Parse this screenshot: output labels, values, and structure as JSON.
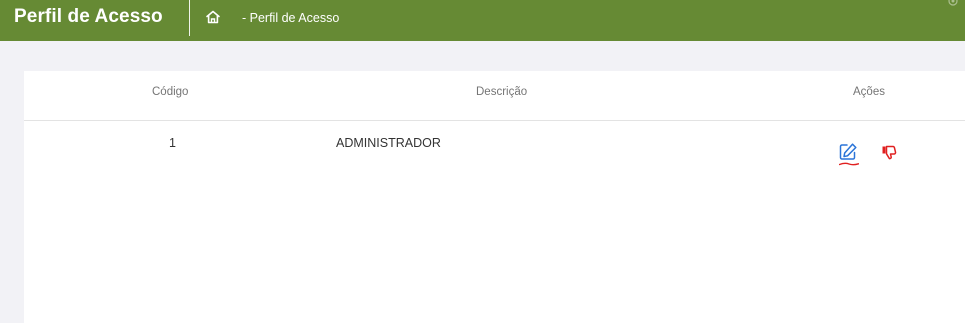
{
  "header": {
    "title": "Perfil de Acesso",
    "breadcrumb": "- Perfil de Acesso",
    "background_color": "#668a34"
  },
  "table": {
    "columns": [
      "Código",
      "Descrição",
      "Ações"
    ],
    "rows": [
      {
        "codigo": "1",
        "descricao": "ADMINISTRADOR",
        "actions": [
          "edit-icon",
          "thumbs-down-icon"
        ]
      }
    ]
  },
  "colors": {
    "edit_icon": "#2a74d8",
    "thumbs_down_icon": "#e02020"
  }
}
